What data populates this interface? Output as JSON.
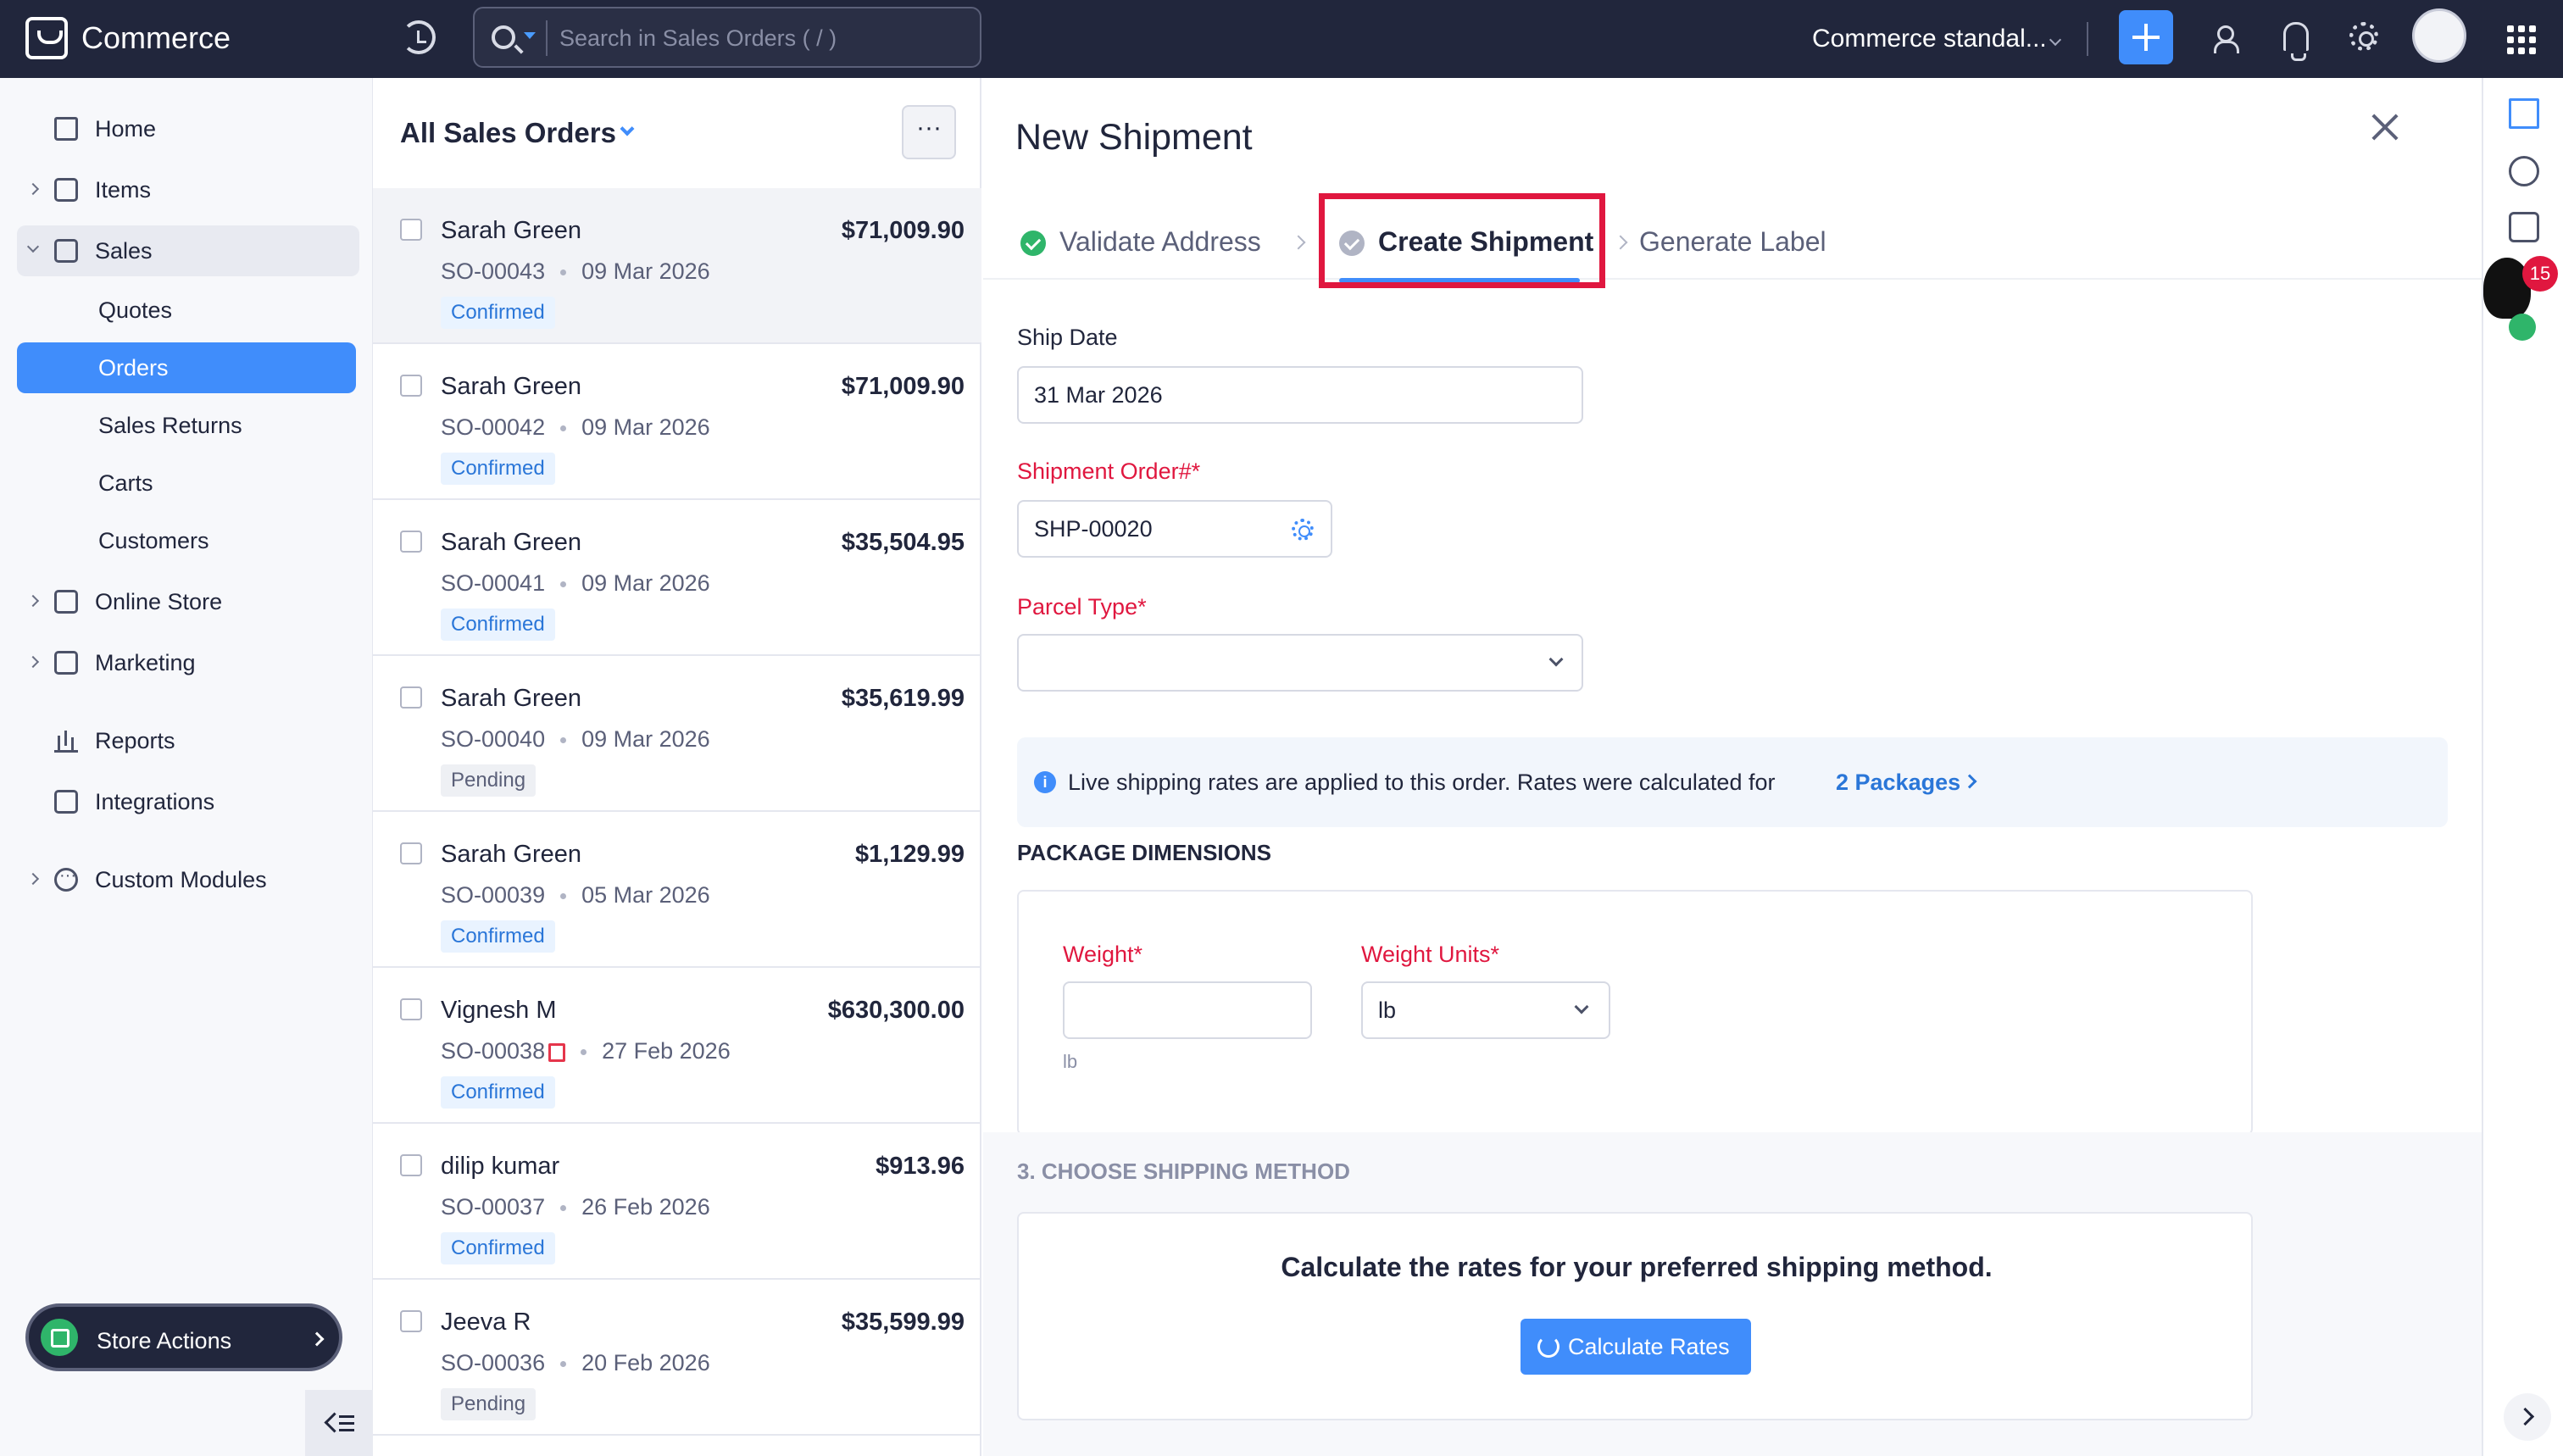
{
  "topbar": {
    "app_name": "Commerce",
    "search_placeholder": "Search in Sales Orders ( / )",
    "org_name": "Commerce standal..."
  },
  "sidebar": {
    "items": {
      "home": "Home",
      "items": "Items",
      "sales": "Sales",
      "quotes": "Quotes",
      "orders": "Orders",
      "sales_returns": "Sales Returns",
      "carts": "Carts",
      "customers": "Customers",
      "online_store": "Online Store",
      "marketing": "Marketing",
      "reports": "Reports",
      "integrations": "Integrations",
      "custom_modules": "Custom Modules"
    },
    "store_actions": "Store Actions"
  },
  "orders_list": {
    "title": "All Sales Orders",
    "more": "···",
    "rows": [
      {
        "customer": "Sarah Green",
        "amount": "$71,009.90",
        "order_no": "SO-00043",
        "date": "09 Mar 2026",
        "status": "Confirmed"
      },
      {
        "customer": "Sarah Green",
        "amount": "$71,009.90",
        "order_no": "SO-00042",
        "date": "09 Mar 2026",
        "status": "Confirmed"
      },
      {
        "customer": "Sarah Green",
        "amount": "$35,504.95",
        "order_no": "SO-00041",
        "date": "09 Mar 2026",
        "status": "Confirmed"
      },
      {
        "customer": "Sarah Green",
        "amount": "$35,619.99",
        "order_no": "SO-00040",
        "date": "09 Mar 2026",
        "status": "Pending"
      },
      {
        "customer": "Sarah Green",
        "amount": "$1,129.99",
        "order_no": "SO-00039",
        "date": "05 Mar 2026",
        "status": "Confirmed"
      },
      {
        "customer": "Vignesh M",
        "amount": "$630,300.00",
        "order_no": "SO-00038",
        "date": "27 Feb 2026",
        "status": "Confirmed"
      },
      {
        "customer": "dilip kumar",
        "amount": "$913.96",
        "order_no": "SO-00037",
        "date": "26 Feb 2026",
        "status": "Confirmed"
      },
      {
        "customer": "Jeeva R",
        "amount": "$35,599.99",
        "order_no": "SO-00036",
        "date": "20 Feb 2026",
        "status": "Pending"
      }
    ]
  },
  "shipment": {
    "title": "New Shipment",
    "steps": {
      "validate": "Validate Address",
      "create": "Create Shipment",
      "generate": "Generate Label"
    },
    "ship_date_label": "Ship Date",
    "ship_date_value": "31 Mar 2026",
    "order_label": "Shipment Order#*",
    "order_value": "SHP-00020",
    "parcel_label": "Parcel Type*",
    "parcel_value": "",
    "info_text": "Live shipping rates are applied to this order. Rates were calculated for",
    "info_link": "2 Packages",
    "package_heading": "PACKAGE DIMENSIONS",
    "weight_label": "Weight*",
    "weight_value": "",
    "weight_hint": "lb",
    "weight_units_label": "Weight Units*",
    "weight_units_value": "lb",
    "method_heading": "3. CHOOSE SHIPPING METHOD",
    "rate_prompt": "Calculate the rates for your preferred shipping method.",
    "calc_button": "Calculate Rates"
  },
  "rail": {
    "badge_count": "15"
  },
  "colors": {
    "accent": "#408dfb",
    "topbar": "#21263c",
    "required": "#e0173f",
    "success": "#2fb56a",
    "highlight_box": "#e0173f"
  }
}
